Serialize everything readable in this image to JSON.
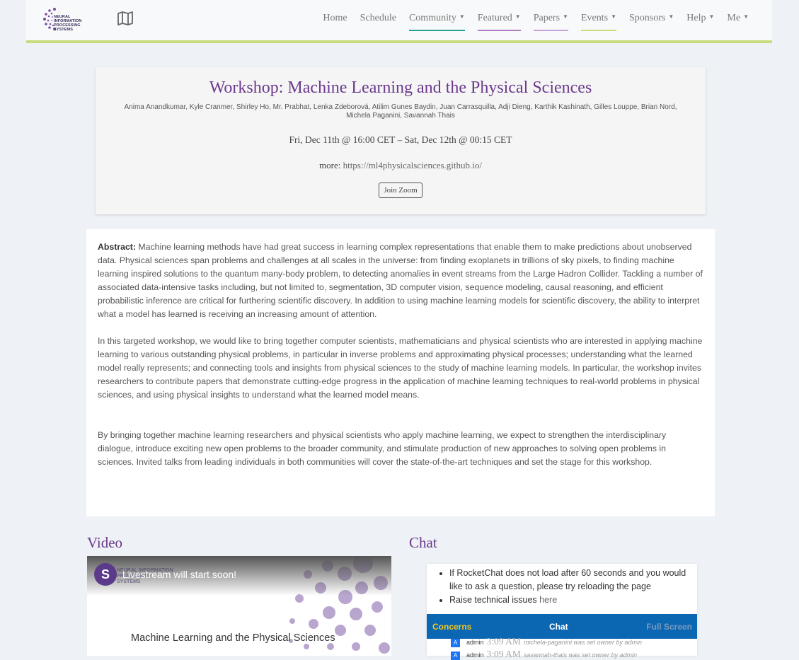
{
  "nav": {
    "logo_text": "NEURAL INFORMATION PROCESSING SYSTEMS",
    "items": [
      {
        "label": "Home",
        "dropdown": false,
        "underline": ""
      },
      {
        "label": "Schedule",
        "dropdown": false,
        "underline": ""
      },
      {
        "label": "Community",
        "dropdown": true,
        "underline": "#2aa198"
      },
      {
        "label": "Featured",
        "dropdown": true,
        "underline": "#b07cc6"
      },
      {
        "label": "Papers",
        "dropdown": true,
        "underline": "#c9a0dc"
      },
      {
        "label": "Events",
        "dropdown": true,
        "underline": "#c7dd7b"
      },
      {
        "label": "Sponsors",
        "dropdown": true,
        "underline": ""
      },
      {
        "label": "Help",
        "dropdown": true,
        "underline": ""
      },
      {
        "label": "Me",
        "dropdown": true,
        "underline": ""
      }
    ],
    "accent_border": "#c7dd7b"
  },
  "header": {
    "title": "Workshop: Machine Learning and the Physical Sciences",
    "authors": "Anima Anandkumar, Kyle Cranmer, Shirley Ho, Mr. Prabhat, Lenka Zdeborová, Atilim Gunes Baydin, Juan Carrasquilla, Adji Dieng, Karthik Kashinath, Gilles Louppe, Brian Nord, Michela Paganini, Savannah Thais",
    "time": "Fri, Dec 11th @ 16:00 CET – Sat, Dec 12th @ 00:15 CET",
    "more_label": "more:",
    "more_link": "https://ml4physicalsciences.github.io/",
    "join_label": "Join Zoom"
  },
  "abstract": {
    "label": "Abstract:",
    "p1": "Machine learning methods have had great success in learning complex representations that enable them to make predictions about unobserved data. Physical sciences span problems and challenges at all scales in the universe: from finding exoplanets in trillions of sky pixels, to finding machine learning inspired solutions to the quantum many-body problem, to detecting anomalies in event streams from the Large Hadron Collider. Tackling a number of associated data-intensive tasks including, but not limited to, segmentation, 3D computer vision, sequence modeling, causal reasoning, and efficient probabilistic inference are critical for furthering scientific discovery. In addition to using machine learning models for scientific discovery, the ability to interpret what a model has learned is receiving an increasing amount of attention.",
    "p2": "In this targeted workshop, we would like to bring together computer scientists, mathematicians and physical scientists who are interested in applying machine learning to various outstanding physical problems, in particular in inverse problems and approximating physical processes; understanding what the learned model really represents; and connecting tools and insights from physical sciences to the study of machine learning models. In particular, the workshop invites researchers to contribute papers that demonstrate cutting-edge progress in the application of machine learning techniques to real-world problems in physical sciences, and using physical insights to understand what the learned model means.",
    "p3": "By bringing together machine learning researchers and physical scientists who apply machine learning, we expect to strengthen the interdisciplinary dialogue, introduce exciting new open problems to the broader community, and stimulate production of new approaches to solving open problems in sciences. Invited talks from leading individuals in both communities will cover the state-of-the-art techniques and set the stage for this workshop."
  },
  "video": {
    "heading": "Video",
    "avatar_letter": "S",
    "title": "Livestream will start soon!",
    "logo_text": "NEURAL INFORMATION PROCESSING SYSTEMS",
    "caption": "Machine Learning and the Physical Sciences"
  },
  "chat": {
    "heading": "Chat",
    "note1": "If RocketChat does not load after 60 seconds and you would like to ask a question, please try reloading the page",
    "note2_prefix": "Raise technical issues",
    "note2_link": "here",
    "tab_concerns": "Concerns",
    "tab_chat": "Chat",
    "tab_fullscreen": "Full Screen",
    "messages": [
      {
        "avatar": "A",
        "user": "admin",
        "time": "3:09 AM",
        "text": "michela-paganini was set owner by admin"
      },
      {
        "avatar": "A",
        "user": "admin",
        "time": "3:09 AM",
        "text": "savannah-thais was set owner by admin"
      }
    ]
  }
}
